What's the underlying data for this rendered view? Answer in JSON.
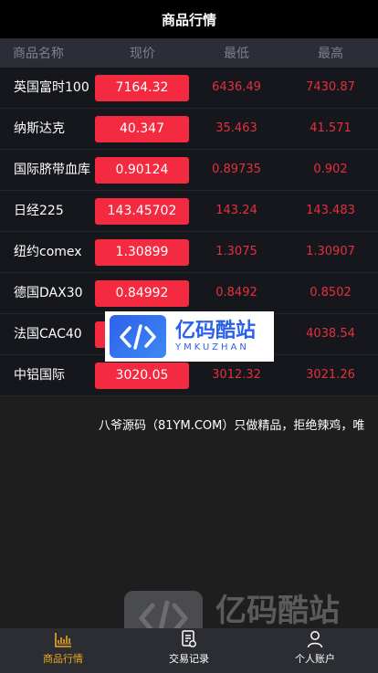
{
  "header": {
    "title": "商品行情"
  },
  "table": {
    "columns": [
      "商品名称",
      "现价",
      "最低",
      "最高"
    ],
    "rows": [
      {
        "name": "英国富时100",
        "price": "7164.32",
        "low": "6436.49",
        "high": "7430.87"
      },
      {
        "name": "纳斯达克",
        "price": "40.347",
        "low": "35.463",
        "high": "41.571"
      },
      {
        "name": "国际脐带血库",
        "price": "0.90124",
        "low": "0.89735",
        "high": "0.902"
      },
      {
        "name": "日经225",
        "price": "143.45702",
        "low": "143.24",
        "high": "143.483"
      },
      {
        "name": "纽约comex",
        "price": "1.30899",
        "low": "1.3075",
        "high": "1.30907"
      },
      {
        "name": "德国DAX30",
        "price": "0.84992",
        "low": "0.8492",
        "high": "0.8502"
      },
      {
        "name": "法国CAC40",
        "price": "",
        "low": "",
        "high": "4038.54"
      },
      {
        "name": "中铝国际",
        "price": "3020.05",
        "low": "3012.32",
        "high": "3021.26"
      }
    ]
  },
  "ticker": {
    "text": "八爷源码（81YM.COM）只做精品，拒绝辣鸡，唯"
  },
  "watermark": {
    "cn": "亿码酷站",
    "en": "YMKUZHAN"
  },
  "tabbar": {
    "items": [
      {
        "label": "商品行情",
        "icon": "chart-icon",
        "active": true
      },
      {
        "label": "交易记录",
        "icon": "record-icon",
        "active": false
      },
      {
        "label": "个人账户",
        "icon": "user-icon",
        "active": false
      }
    ]
  },
  "colors": {
    "accent": "#f42a41",
    "active_tab": "#f2a91a",
    "background": "#1e1e1e"
  }
}
